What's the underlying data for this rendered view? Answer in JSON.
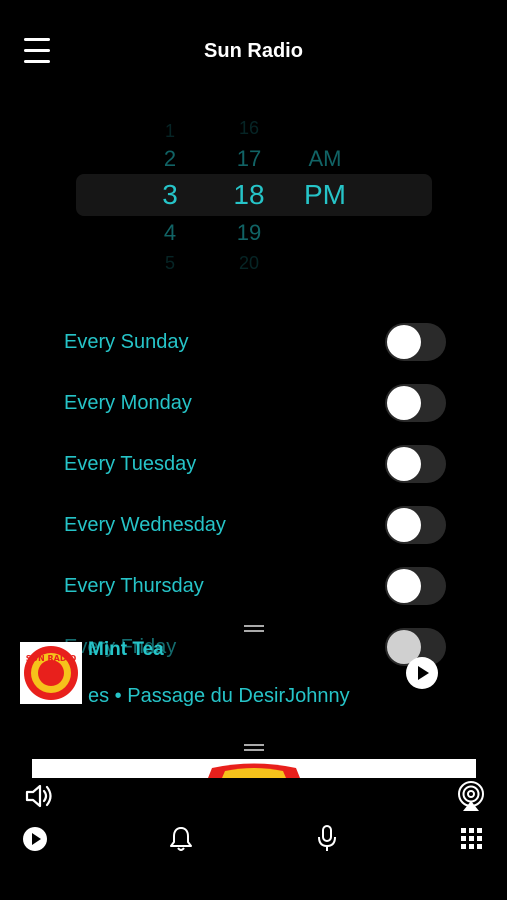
{
  "header": {
    "title": "Sun Radio",
    "menu_icon": "hamburger-menu-icon"
  },
  "time_picker": {
    "hours": [
      "1",
      "2",
      "3",
      "4",
      "5"
    ],
    "minutes": [
      "16",
      "17",
      "18",
      "19",
      "20"
    ],
    "periods": [
      "AM",
      "PM"
    ],
    "selected": {
      "hour": "3",
      "minute": "18",
      "period": "PM"
    }
  },
  "days": [
    {
      "label": "Every Sunday",
      "on": false
    },
    {
      "label": "Every Monday",
      "on": false
    },
    {
      "label": "Every Tuesday",
      "on": false
    },
    {
      "label": "Every Wednesday",
      "on": false
    },
    {
      "label": "Every Thursday",
      "on": false
    },
    {
      "label": "Every Friday",
      "on": false
    }
  ],
  "mini_player": {
    "title": "Mint Tea",
    "subtitle": "es • Passage du DesirJohnny Hallyday",
    "logo_text": "SUN RADIO",
    "play_icon": "play-icon"
  },
  "bottom_bar": {
    "volume_icon": "volume-icon",
    "airplay_icon": "airplay-icon",
    "tabs": [
      "play-icon",
      "bell-icon",
      "microphone-icon",
      "grid-icon"
    ]
  },
  "colors": {
    "accent": "#26c4c8",
    "background": "#000000",
    "toggle_off": "#2a2a2a"
  }
}
